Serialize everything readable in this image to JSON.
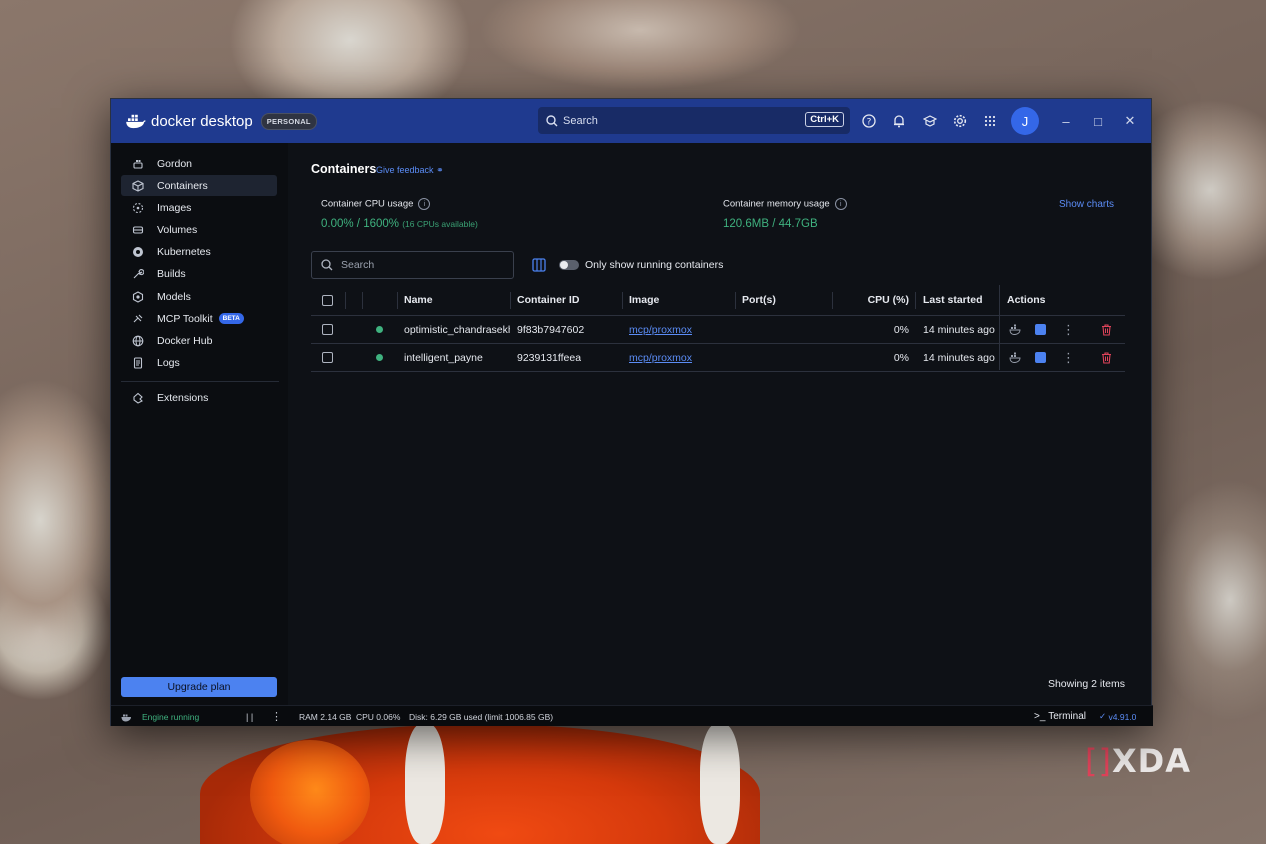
{
  "app": {
    "brand": "docker desktop",
    "plan_badge": "PERSONAL",
    "search_placeholder": "Search",
    "search_shortcut": "Ctrl+K",
    "avatar_initial": "J"
  },
  "sidebar": {
    "items": [
      {
        "label": "Gordon",
        "icon": "gordon-icon"
      },
      {
        "label": "Containers",
        "icon": "containers-icon",
        "active": true
      },
      {
        "label": "Images",
        "icon": "images-icon"
      },
      {
        "label": "Volumes",
        "icon": "volumes-icon"
      },
      {
        "label": "Kubernetes",
        "icon": "kubernetes-icon"
      },
      {
        "label": "Builds",
        "icon": "builds-icon"
      },
      {
        "label": "Models",
        "icon": "models-icon"
      },
      {
        "label": "MCP Toolkit",
        "icon": "mcp-icon",
        "badge": "BETA"
      },
      {
        "label": "Docker Hub",
        "icon": "hub-icon"
      },
      {
        "label": "Logs",
        "icon": "logs-icon"
      },
      {
        "label": "Extensions",
        "icon": "extensions-icon"
      }
    ],
    "upgrade_label": "Upgrade plan"
  },
  "main": {
    "title": "Containers",
    "feedback_label": "Give feedback",
    "cpu_label": "Container CPU usage",
    "cpu_value": "0.00% / 1600%",
    "cpu_note": "(16 CPUs available)",
    "mem_label": "Container memory usage",
    "mem_value": "120.6MB / 44.7GB",
    "show_charts": "Show charts",
    "search_placeholder": "Search",
    "toggle_label": "Only show running containers",
    "columns": [
      "Name",
      "Container ID",
      "Image",
      "Port(s)",
      "CPU (%)",
      "Last started",
      "Actions"
    ],
    "rows": [
      {
        "name": "optimistic_chandrasekhar",
        "id": "9f83b7947602",
        "image": "mcp/proxmox",
        "ports": "",
        "cpu": "0%",
        "started": "14 minutes ago"
      },
      {
        "name": "intelligent_payne",
        "id": "9239131ffeea",
        "image": "mcp/proxmox",
        "ports": "",
        "cpu": "0%",
        "started": "14 minutes ago"
      }
    ],
    "showing": "Showing 2 items"
  },
  "statusbar": {
    "engine": "Engine running",
    "ram": "RAM 2.14 GB",
    "cpu": "CPU 0.06%",
    "disk": "Disk: 6.29 GB used (limit 1006.85 GB)",
    "terminal": "Terminal",
    "version": "v4.91.0"
  },
  "colors": {
    "titlebar": "#1f3a8f",
    "accent": "#4c82f0",
    "running": "#3fb27f",
    "danger": "#e0435a"
  },
  "watermark": "XDA"
}
